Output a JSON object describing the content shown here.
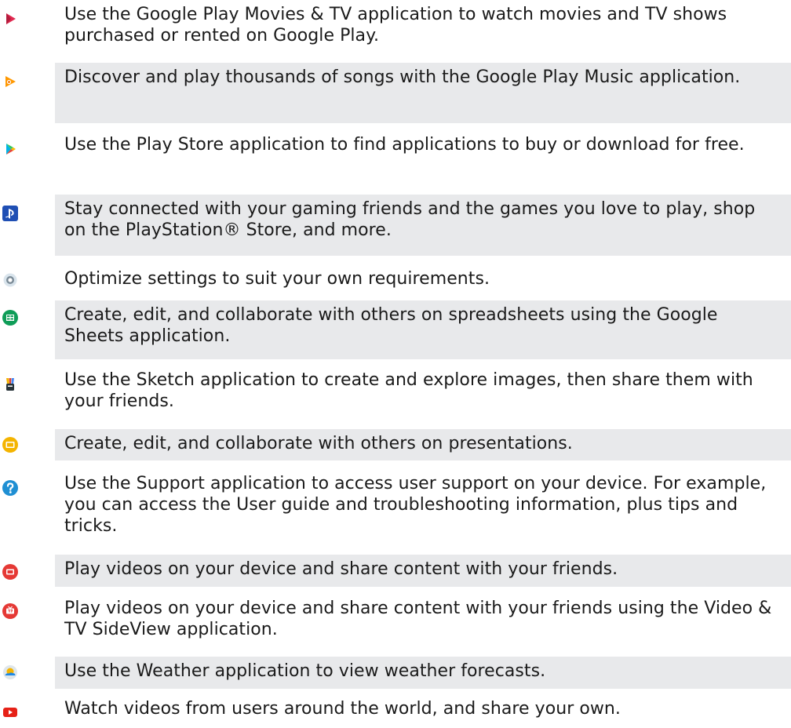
{
  "items": [
    {
      "icon": "google-play-movies-icon",
      "text": "Use the Google Play Movies & TV application to watch movies and TV shows purchased or rented on Google Play."
    },
    {
      "icon": "google-play-music-icon",
      "text": "Discover and play thousands of songs with the Google Play Music application."
    },
    {
      "icon": "play-store-icon",
      "text": "Use the Play Store application to find applications to buy or download for free."
    },
    {
      "icon": "playstation-icon",
      "text": "Stay connected with your gaming friends and the games you love to play, shop on the PlayStation® Store, and more."
    },
    {
      "icon": "settings-icon",
      "text": "Optimize settings to suit your own requirements."
    },
    {
      "icon": "google-sheets-icon",
      "text": "Create, edit, and collaborate with others on spreadsheets using the Google Sheets application."
    },
    {
      "icon": "sketch-icon",
      "text": "Use the Sketch application to create and explore images, then share them with your friends."
    },
    {
      "icon": "google-slides-icon",
      "text": "Create, edit, and collaborate with others on presentations."
    },
    {
      "icon": "support-icon",
      "text": "Use the Support application to access user support on your device. For example, you can access the User guide and troubleshooting information, plus tips and tricks."
    },
    {
      "icon": "video-icon",
      "text": "Play videos on your device and share content with your friends."
    },
    {
      "icon": "video-tv-sideview-icon",
      "text": "Play videos on your device and share content with your friends using the Video & TV SideView application."
    },
    {
      "icon": "weather-icon",
      "text": "Use the Weather application to view weather forecasts."
    },
    {
      "icon": "youtube-icon",
      "text": "Watch videos from users around the world, and share your own."
    }
  ]
}
